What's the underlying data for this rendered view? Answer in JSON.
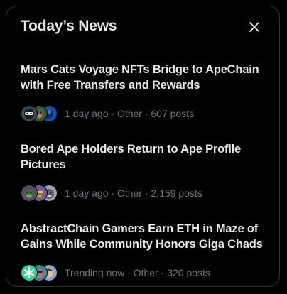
{
  "panel": {
    "title": "Today’s News",
    "close_icon": "close-icon"
  },
  "news": [
    {
      "headline": "Mars Cats Voyage NFTs Bridge to ApeChain with Free Transfers and Rewards",
      "meta": "1 day ago · Other · 607 posts",
      "avatars": [
        "cat-nft-avatar",
        "ape-nft-avatar",
        "blue-nft-avatar"
      ]
    },
    {
      "headline": "Bored Ape Holders Return to Ape Profile Pictures",
      "meta": "1 day ago · Other · 2,159 posts",
      "avatars": [
        "ape-green-avatar",
        "ape-purple-avatar",
        "ape-gray-avatar"
      ]
    },
    {
      "headline": "AbstractChain Gamers Earn ETH in Maze of Gains While Community Honors Giga Chads",
      "meta": "Trending now · Other · 320 posts",
      "avatars": [
        "abstract-logo-avatar",
        "gamer-avatar",
        "chad-avatar"
      ]
    }
  ],
  "colors": {
    "background": "#000000",
    "border": "#2f3336",
    "text_primary": "#e7e9ea",
    "text_secondary": "#71767b",
    "abstract_green": "#2ed39a"
  }
}
